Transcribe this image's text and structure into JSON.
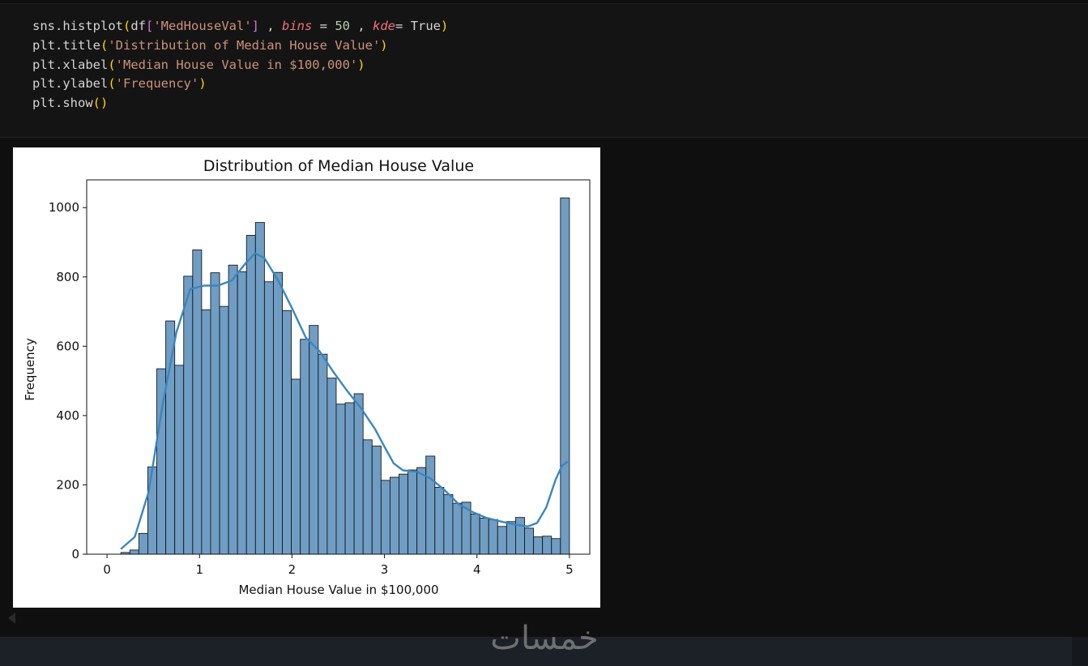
{
  "code": {
    "lines": [
      [
        {
          "t": "sns.histplot",
          "c": "t-fn"
        },
        {
          "t": "(",
          "c": "t-br"
        },
        {
          "t": "df",
          "c": "t-fn"
        },
        {
          "t": "[",
          "c": "t-br2"
        },
        {
          "t": "'MedHouseVal'",
          "c": "t-str"
        },
        {
          "t": "]",
          "c": "t-br2"
        },
        {
          "t": " , ",
          "c": "t-op"
        },
        {
          "t": "bins",
          "c": "t-kw"
        },
        {
          "t": " = ",
          "c": "t-op"
        },
        {
          "t": "50",
          "c": "t-num"
        },
        {
          "t": " , ",
          "c": "t-op"
        },
        {
          "t": "kde",
          "c": "t-kw"
        },
        {
          "t": "= ",
          "c": "t-op"
        },
        {
          "t": "True",
          "c": "t-bool"
        },
        {
          "t": ")",
          "c": "t-br"
        }
      ],
      [
        {
          "t": "plt.title",
          "c": "t-fn"
        },
        {
          "t": "(",
          "c": "t-br"
        },
        {
          "t": "'Distribution of Median House Value'",
          "c": "t-str"
        },
        {
          "t": ")",
          "c": "t-br"
        }
      ],
      [
        {
          "t": "plt.xlabel",
          "c": "t-fn"
        },
        {
          "t": "(",
          "c": "t-br"
        },
        {
          "t": "'Median House Value in $100,000'",
          "c": "t-str"
        },
        {
          "t": ")",
          "c": "t-br"
        }
      ],
      [
        {
          "t": "plt.ylabel",
          "c": "t-fn"
        },
        {
          "t": "(",
          "c": "t-br"
        },
        {
          "t": "'Frequency'",
          "c": "t-str"
        },
        {
          "t": ")",
          "c": "t-br"
        }
      ],
      [
        {
          "t": "plt.show",
          "c": "t-fn"
        },
        {
          "t": "()",
          "c": "t-br"
        }
      ]
    ]
  },
  "chart_data": {
    "type": "bar",
    "title": "Distribution of Median House Value",
    "xlabel": "Median House Value in $100,000",
    "ylabel": "Frequency",
    "xlim": [
      -0.22,
      5.22
    ],
    "ylim": [
      0,
      1080
    ],
    "x_ticks": [
      0,
      1,
      2,
      3,
      4,
      5
    ],
    "y_ticks": [
      0,
      200,
      400,
      600,
      800,
      1000
    ],
    "bin_start": 0.15,
    "bin_width": 0.097,
    "values": [
      5,
      12,
      60,
      252,
      535,
      673,
      545,
      802,
      878,
      705,
      812,
      715,
      834,
      815,
      920,
      957,
      786,
      813,
      703,
      505,
      620,
      660,
      577,
      508,
      433,
      437,
      463,
      330,
      312,
      213,
      222,
      231,
      243,
      250,
      283,
      193,
      172,
      147,
      150,
      116,
      104,
      100,
      80,
      94,
      106,
      75,
      50,
      52,
      45,
      1028
    ],
    "kde": [
      [
        0.15,
        15
      ],
      [
        0.3,
        50
      ],
      [
        0.45,
        180
      ],
      [
        0.6,
        430
      ],
      [
        0.75,
        640
      ],
      [
        0.9,
        765
      ],
      [
        1.05,
        775
      ],
      [
        1.2,
        775
      ],
      [
        1.35,
        790
      ],
      [
        1.5,
        840
      ],
      [
        1.6,
        868
      ],
      [
        1.7,
        855
      ],
      [
        1.85,
        790
      ],
      [
        2.0,
        710
      ],
      [
        2.15,
        625
      ],
      [
        2.3,
        585
      ],
      [
        2.45,
        525
      ],
      [
        2.6,
        470
      ],
      [
        2.75,
        420
      ],
      [
        2.9,
        360
      ],
      [
        3.0,
        310
      ],
      [
        3.1,
        262
      ],
      [
        3.2,
        242
      ],
      [
        3.35,
        238
      ],
      [
        3.5,
        218
      ],
      [
        3.65,
        185
      ],
      [
        3.8,
        145
      ],
      [
        3.95,
        122
      ],
      [
        4.1,
        105
      ],
      [
        4.25,
        95
      ],
      [
        4.4,
        86
      ],
      [
        4.55,
        80
      ],
      [
        4.65,
        90
      ],
      [
        4.75,
        135
      ],
      [
        4.85,
        215
      ],
      [
        4.92,
        255
      ],
      [
        4.98,
        268
      ]
    ],
    "bar_fill": "#6f9dc4",
    "bar_edge": "#1a1a1a",
    "kde_color": "#3a86bf",
    "grid": false
  },
  "watermark": "خمسات",
  "colors": {
    "background": "#0f0f0f",
    "cell_bg": "#141414",
    "bottom_bar": "#1c2027"
  }
}
